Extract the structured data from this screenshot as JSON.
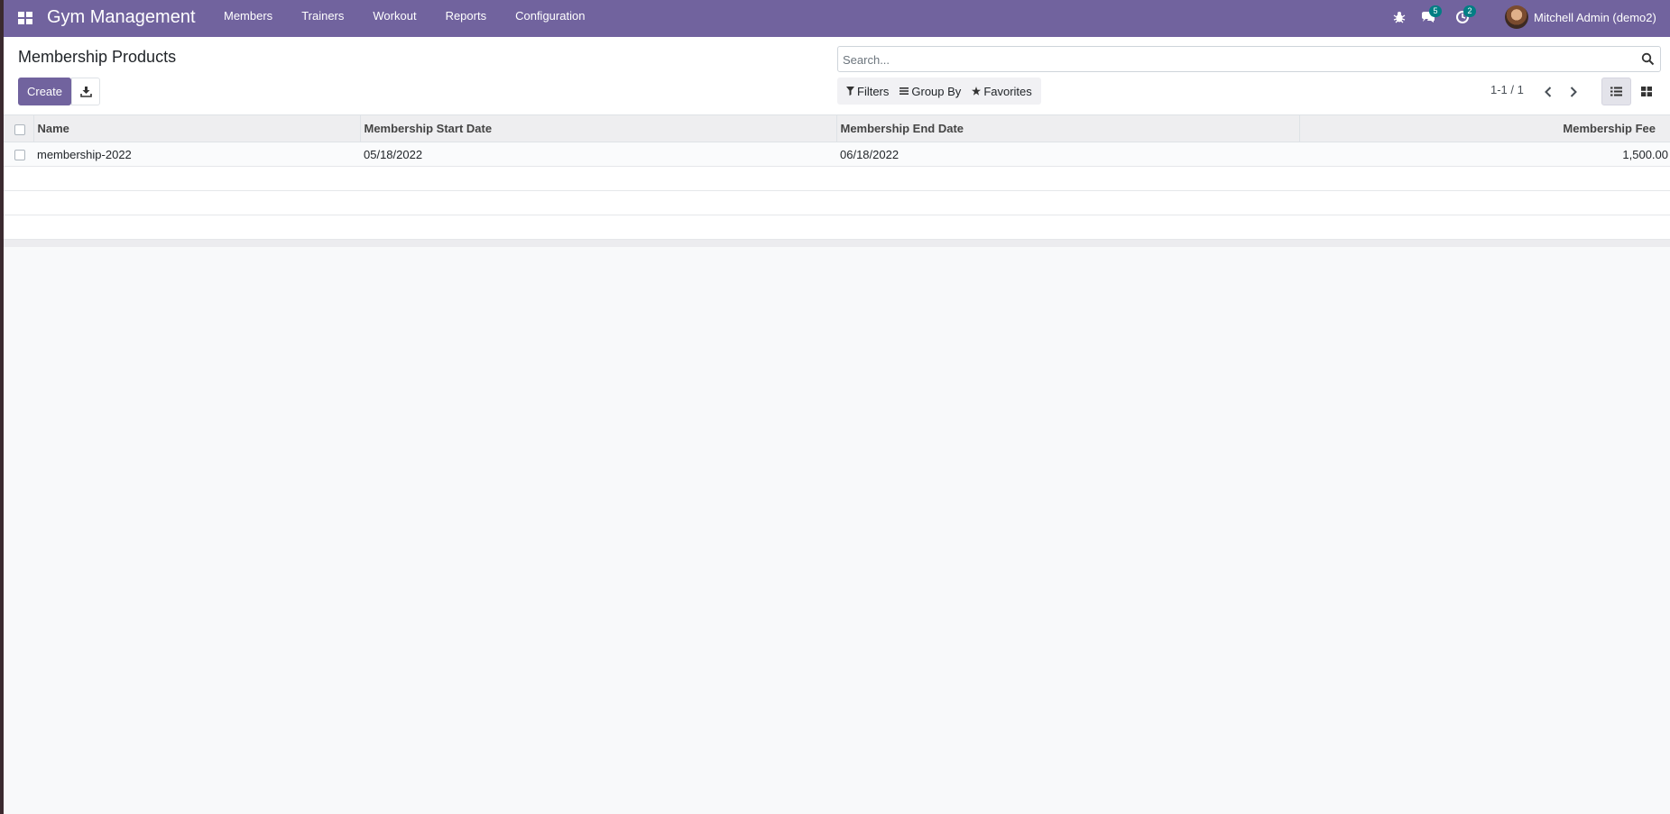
{
  "app": {
    "title": "Gym Management"
  },
  "navbar": {
    "menu": [
      "Members",
      "Trainers",
      "Workout",
      "Reports",
      "Configuration"
    ],
    "messages_badge": "5",
    "activities_badge": "2",
    "user_name": "Mitchell Admin (demo2)",
    "brand_color": "#71639e"
  },
  "control_panel": {
    "title": "Membership Products",
    "create_label": "Create",
    "search_placeholder": "Search...",
    "filters_label": "Filters",
    "groupby_label": "Group By",
    "favorites_label": "Favorites",
    "pager": "1-1 / 1"
  },
  "list": {
    "columns": [
      "Name",
      "Membership Start Date",
      "Membership End Date",
      "Membership Fee"
    ],
    "rows": [
      {
        "name": "membership-2022",
        "start": "05/18/2022",
        "end": "06/18/2022",
        "fee": "1,500.00"
      }
    ]
  }
}
